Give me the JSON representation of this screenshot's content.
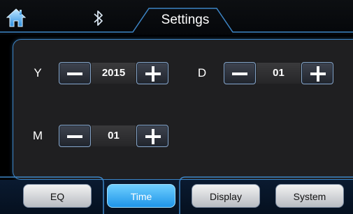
{
  "header": {
    "home_icon": "home-icon",
    "bluetooth_icon": "bluetooth-icon",
    "title": "Settings"
  },
  "date": {
    "year": {
      "label": "Y",
      "value": "2015"
    },
    "month": {
      "label": "M",
      "value": "01"
    },
    "day": {
      "label": "D",
      "value": "01"
    }
  },
  "tabs": [
    {
      "label": "EQ",
      "active": false
    },
    {
      "label": "Time",
      "active": true
    },
    {
      "label": "Display",
      "active": false
    },
    {
      "label": "System",
      "active": false
    }
  ],
  "colors": {
    "accent": "#3d85c6",
    "active_tab": "#1f95e8"
  }
}
